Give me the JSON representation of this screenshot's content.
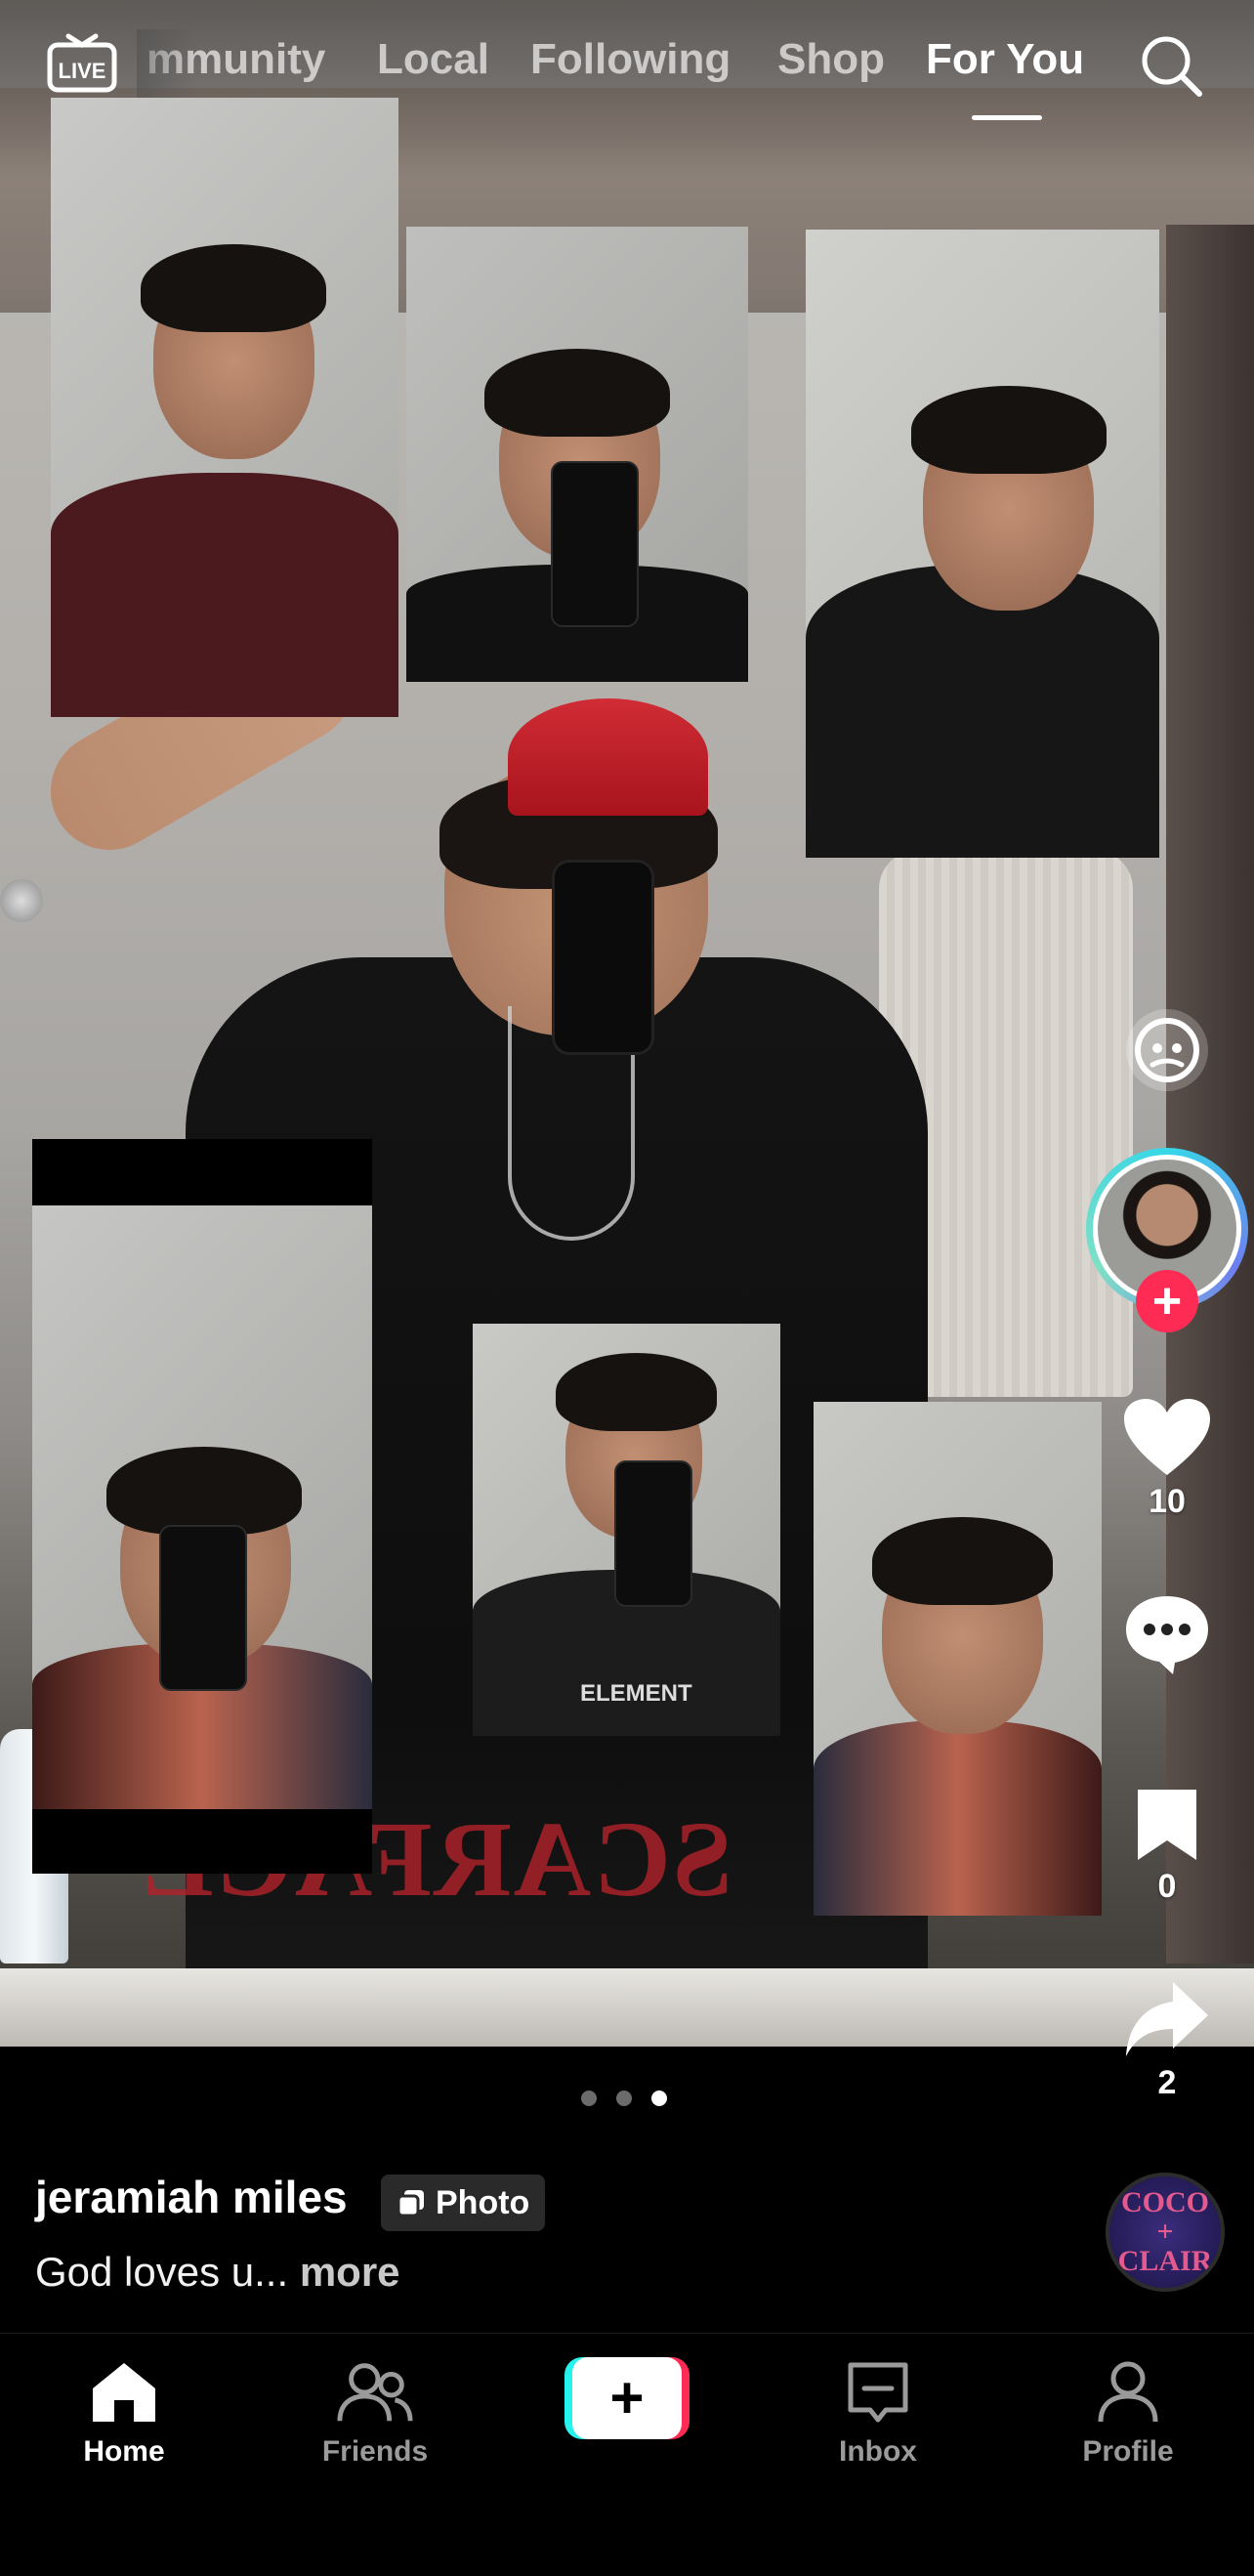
{
  "top_nav": {
    "live_label": "LIVE",
    "tabs": [
      {
        "label": "mmunity",
        "active": false
      },
      {
        "label": "Local",
        "active": false
      },
      {
        "label": "Following",
        "active": false
      },
      {
        "label": "Shop",
        "active": false
      },
      {
        "label": "For You",
        "active": true
      }
    ],
    "search_icon": "search-icon"
  },
  "post": {
    "type": "photo",
    "image_count": 3,
    "current_image": 3,
    "author": "jeramiah miles",
    "badge_label": "Photo",
    "caption": "God loves u...",
    "more_label": "more",
    "tile_print": "ELEMENT"
  },
  "actions": {
    "likes": "10",
    "comments": "",
    "saves": "0",
    "shares": "2",
    "follow_icon": "plus-icon"
  },
  "music": {
    "disc_text_line1": "COCO",
    "disc_text_line2": "+",
    "disc_text_line3": "CLAIR"
  },
  "bottom_nav": {
    "items": [
      {
        "label": "Home",
        "icon": "home-icon",
        "active": true
      },
      {
        "label": "Friends",
        "icon": "friends-icon",
        "active": false
      },
      {
        "label": "",
        "icon": "create-icon",
        "active": false
      },
      {
        "label": "Inbox",
        "icon": "inbox-icon",
        "active": false
      },
      {
        "label": "Profile",
        "icon": "profile-icon",
        "active": false
      }
    ]
  },
  "colors": {
    "accent": "#fe2c55",
    "accent_cyan": "#25f4ee",
    "background": "#000000"
  }
}
